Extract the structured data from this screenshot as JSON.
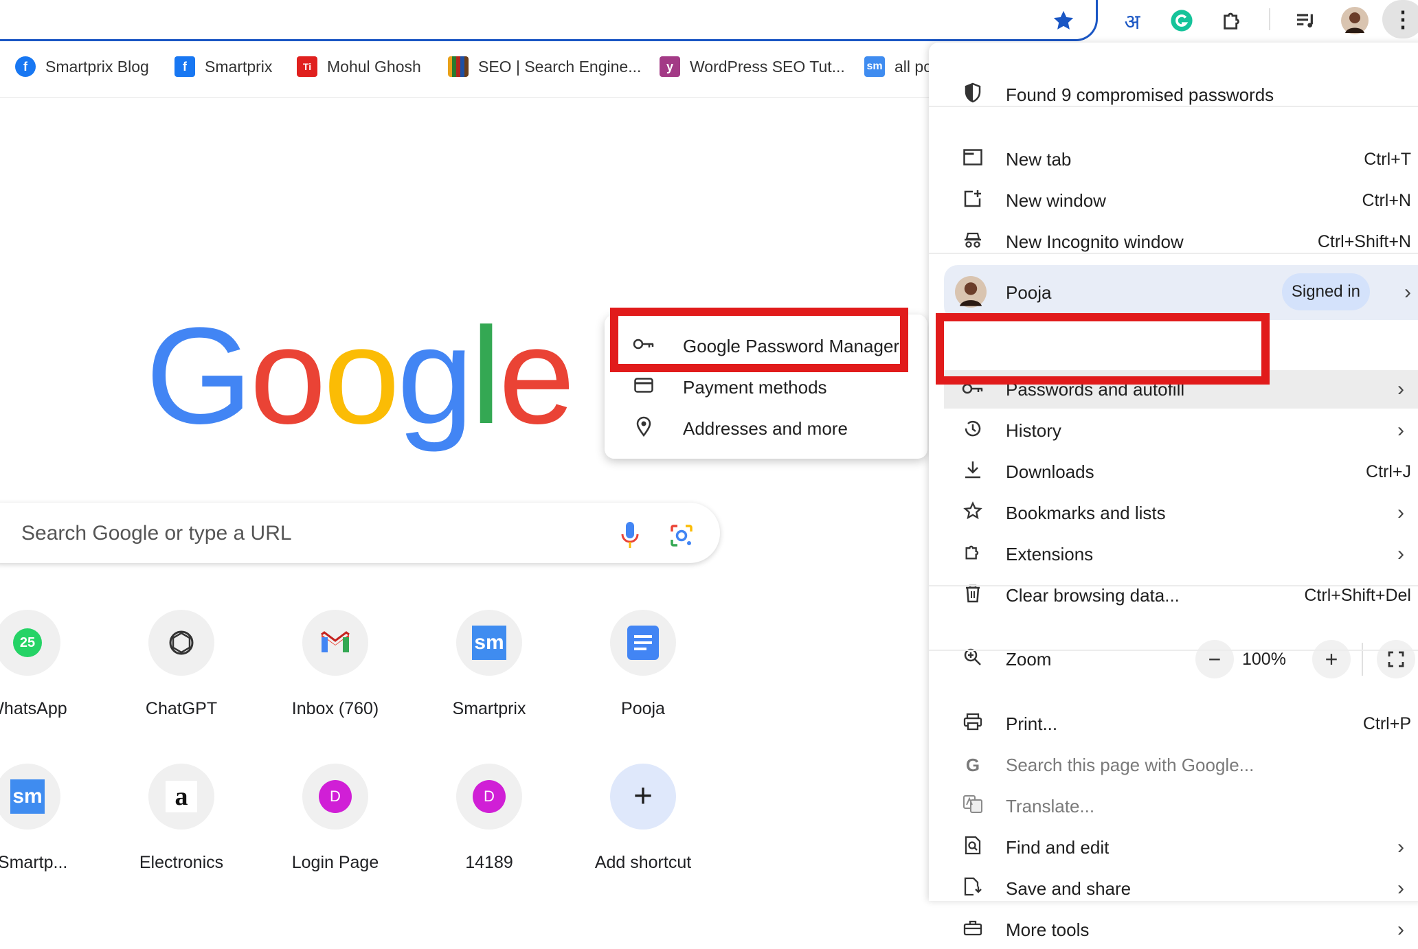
{
  "toolbar": {
    "hindi_glyph": "अ",
    "menu_glyph": "⋮"
  },
  "bookmarks": [
    {
      "label": "Smartprix Blog",
      "color": "#1877f2",
      "glyph": "f"
    },
    {
      "label": "Smartprix",
      "color": "#1877f2",
      "glyph": "f"
    },
    {
      "label": "Mohul Ghosh",
      "color": "#e0201e",
      "glyph": "Ti"
    },
    {
      "label": "SEO | Search Engine...",
      "color": "#7a4b1a",
      "glyph": ""
    },
    {
      "label": "WordPress SEO Tut...",
      "color": "#a33a86",
      "glyph": "y"
    },
    {
      "label": "all pc",
      "color": "#3f8cf0",
      "glyph": "sm"
    }
  ],
  "logo": {
    "letters": [
      "G",
      "o",
      "o",
      "g",
      "l",
      "e"
    ],
    "colors": [
      "#4285F4",
      "#EA4335",
      "#FBBC05",
      "#4285F4",
      "#34A853",
      "#EA4335"
    ]
  },
  "search": {
    "placeholder": "Search Google or type a URL"
  },
  "shortcuts_row1": [
    {
      "label": "WhatsApp",
      "icon": "whatsapp-icon",
      "badge": "25"
    },
    {
      "label": "ChatGPT",
      "icon": "chatgpt-icon",
      "badge": ""
    },
    {
      "label": "Inbox (760)",
      "icon": "gmail-icon",
      "badge": ""
    },
    {
      "label": "Smartprix",
      "icon": "smartprix-icon",
      "badge": "sm"
    },
    {
      "label": "Pooja",
      "icon": "docs-icon",
      "badge": ""
    }
  ],
  "shortcuts_row2": [
    {
      "label": "‹ Smartp...",
      "icon": "smartprix-icon",
      "badge": "sm"
    },
    {
      "label": "Electronics",
      "icon": "amazon-icon",
      "badge": "a"
    },
    {
      "label": "Login Page",
      "icon": "letter-d-icon",
      "badge": "D"
    },
    {
      "label": "14189",
      "icon": "letter-d-icon",
      "badge": "D"
    },
    {
      "label": "Add shortcut",
      "icon": "plus-icon",
      "badge": "+"
    }
  ],
  "submenu": {
    "items": [
      {
        "label": "Google Password Manager",
        "glyph": "⚷"
      },
      {
        "label": "Payment methods",
        "glyph": "▭"
      },
      {
        "label": "Addresses and more",
        "glyph": "⌖"
      }
    ]
  },
  "menu": {
    "alert": "Found 9 compromised passwords",
    "new_tab": {
      "label": "New tab",
      "shortcut": "Ctrl+T"
    },
    "new_window": {
      "label": "New window",
      "shortcut": "Ctrl+N"
    },
    "incognito": {
      "label": "New Incognito window",
      "shortcut": "Ctrl+Shift+N"
    },
    "profile": {
      "name": "Pooja",
      "status": "Signed in"
    },
    "passwords": {
      "label": "Passwords and autofill"
    },
    "history": {
      "label": "History"
    },
    "downloads": {
      "label": "Downloads",
      "shortcut": "Ctrl+J"
    },
    "bookmarks": {
      "label": "Bookmarks and lists"
    },
    "extensions": {
      "label": "Extensions"
    },
    "clear": {
      "label": "Clear browsing data...",
      "shortcut": "Ctrl+Shift+Del"
    },
    "zoom": {
      "label": "Zoom",
      "minus": "−",
      "value": "100%",
      "plus": "+"
    },
    "print": {
      "label": "Print...",
      "shortcut": "Ctrl+P"
    },
    "search_page": {
      "label": "Search this page with Google..."
    },
    "translate": {
      "label": "Translate..."
    },
    "find": {
      "label": "Find and edit"
    },
    "save": {
      "label": "Save and share"
    },
    "more_tools": {
      "label": "More tools"
    }
  },
  "colors": {
    "highlight": "#e11b1b",
    "accent": "#1a56c4"
  }
}
